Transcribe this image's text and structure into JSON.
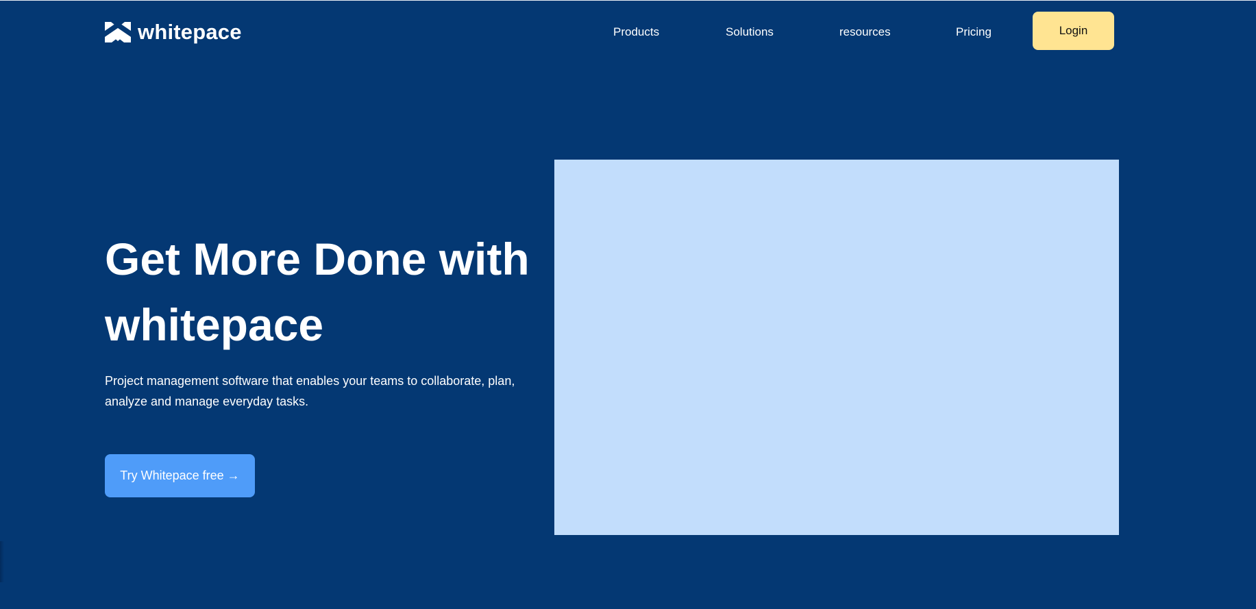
{
  "brand": {
    "name": "whitepace",
    "logo_icon": "whitepace-chevron-logo-icon"
  },
  "nav": {
    "items": [
      {
        "label": "Products"
      },
      {
        "label": "Solutions"
      },
      {
        "label": "resources"
      },
      {
        "label": "Pricing"
      }
    ],
    "login_label": "Login"
  },
  "hero": {
    "title": "Get More Done with whitepace",
    "subtitle": "Project management software that enables your teams to collaborate, plan, analyze and manage everyday tasks.",
    "cta_label": "Try Whitepace free →"
  },
  "colors": {
    "background": "#043873",
    "login_button": "#ffe492",
    "cta_button": "#4f9cf9",
    "image_placeholder": "#c2ddfc"
  }
}
